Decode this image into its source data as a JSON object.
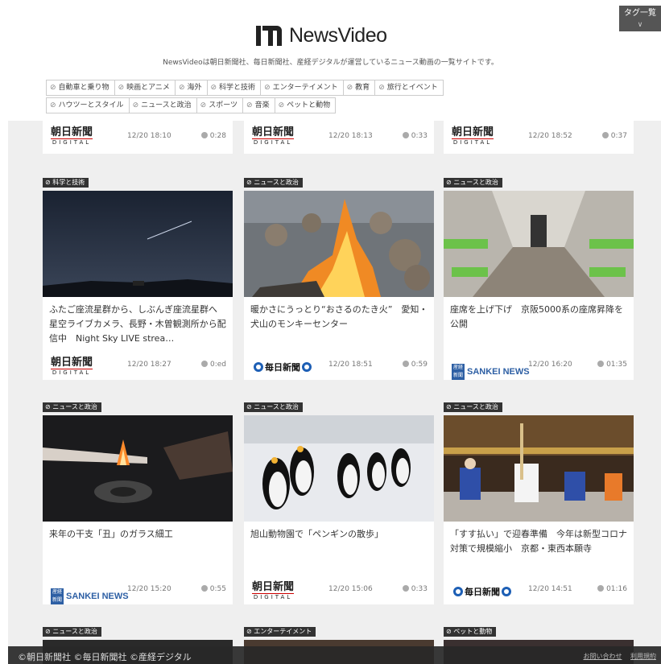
{
  "header": {
    "site_name": "NewsVideo",
    "tagline": "NewsVideoは朝日新聞社、毎日新聞社、産経デジタルが運営しているニュース動画の一覧サイトです。",
    "tag_list_button": "タグ一覧",
    "tags_row1": [
      "自動車と乗り物",
      "映画とアニメ",
      "海外",
      "科学と技術",
      "エンターテイメント",
      "教育",
      "旅行とイベント"
    ],
    "tags_row2": [
      "ハウツーとスタイル",
      "ニュースと政治",
      "スポーツ",
      "音楽",
      "ペットと動物"
    ]
  },
  "sources": {
    "asahi_jp": "朝日新聞",
    "asahi_digital": "DIGITAL",
    "mainichi": "毎日新聞",
    "sankei_box": "産経 新聞",
    "sankei_name": "SANKEI NEWS"
  },
  "top_row": [
    {
      "time": "12/20 18:10",
      "duration": "0:28",
      "source": "asahi"
    },
    {
      "time": "12/20 18:13",
      "duration": "0:33",
      "source": "asahi"
    },
    {
      "time": "12/20 18:52",
      "duration": "0:37",
      "source": "asahi"
    }
  ],
  "cards": [
    {
      "category": "科学と技術",
      "title": "ふたご座流星群から、しぶんぎ座流星群へ　星空ライブカメラ、長野・木曽観測所から配信中　Night Sky LIVE strea…",
      "time": "12/20 18:27",
      "duration": "0:ed",
      "source": "asahi"
    },
    {
      "category": "ニュースと政治",
      "title": "暖かさにうっとり“おさるのたき火”　愛知・犬山のモンキーセンター",
      "time": "12/20 18:51",
      "duration": "0:59",
      "source": "mainichi"
    },
    {
      "category": "ニュースと政治",
      "title": "座席を上げ下げ　京阪5000系の座席昇降を公開",
      "time": "12/20 16:20",
      "duration": "01:35",
      "source": "sankei"
    },
    {
      "category": "ニュースと政治",
      "title": "来年の干支「丑」のガラス細工",
      "time": "12/20 15:20",
      "duration": "0:55",
      "source": "sankei"
    },
    {
      "category": "ニュースと政治",
      "title": "旭山動物園で「ペンギンの散歩」",
      "time": "12/20 15:06",
      "duration": "0:33",
      "source": "asahi"
    },
    {
      "category": "ニュースと政治",
      "title": "「すす払い」で迎春準備　今年は新型コロナ対策で規模縮小　京都・東西本願寺",
      "time": "12/20 14:51",
      "duration": "01:16",
      "source": "mainichi"
    }
  ],
  "bottom_row": [
    {
      "category": "ニュースと政治"
    },
    {
      "category": "エンターテイメント"
    },
    {
      "category": "ペットと動物"
    }
  ],
  "footer": {
    "copyright": "©朝日新聞社 ©毎日新聞社 ©産経デジタル",
    "contact": "お問い合わせ",
    "terms": "利用規約"
  }
}
